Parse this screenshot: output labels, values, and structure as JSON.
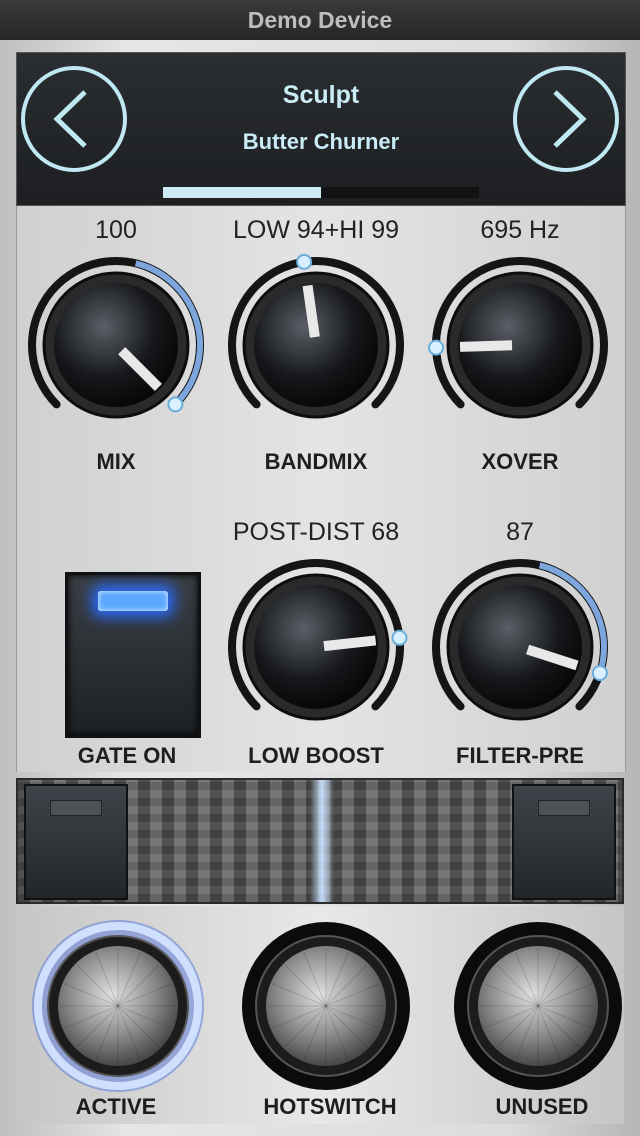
{
  "window": {
    "title": "Demo Device"
  },
  "header": {
    "preset_name": "Sculpt",
    "preset_sub": "Butter Churner",
    "prev_icon": "chevron-left-icon",
    "next_icon": "chevron-right-icon",
    "bank_progress": 0.5
  },
  "knobs": [
    {
      "id": "mix",
      "value_text": "100",
      "label": "MIX",
      "level": 1.0
    },
    {
      "id": "bandmix",
      "value_text": "LOW 94+HI 99",
      "label": "BANDMIX",
      "level": 0.47
    },
    {
      "id": "xover",
      "value_text": "695 Hz",
      "label": "XOVER",
      "level": 0.16
    },
    {
      "id": "low-boost",
      "value_text": "POST-DIST  68",
      "label": "LOW BOOST",
      "level": 0.81
    },
    {
      "id": "filter-pre",
      "value_text": "87",
      "label": "FILTER-PRE",
      "level": 0.9
    }
  ],
  "gate": {
    "label": "GATE ON",
    "state": "on"
  },
  "footswitches": [
    {
      "label": "ACTIVE",
      "active": true
    },
    {
      "label": "HOTSWITCH",
      "active": false
    },
    {
      "label": "UNUSED",
      "active": false
    }
  ],
  "colors": {
    "accent": "#c9ecf6",
    "gate_light": "#5aa8ff",
    "active_ring": "#8fb4ff"
  }
}
